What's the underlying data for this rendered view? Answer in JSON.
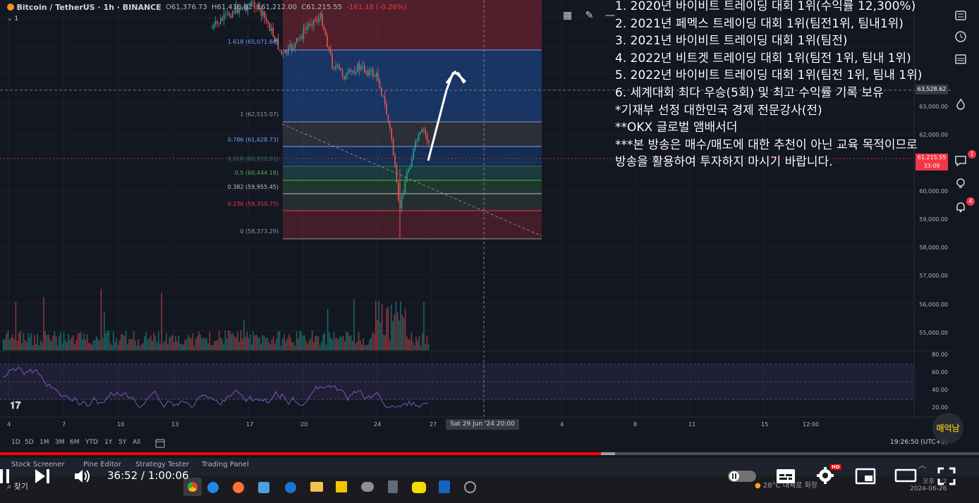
{
  "header": {
    "symbol": "Bitcoin / TetherUS · 1h · BINANCE",
    "interval_badge": "1",
    "ohlc": {
      "o": "O61,376.73",
      "h": "H61,418.82",
      "l": "L61,212.00",
      "c": "C61,215.55",
      "chg": "-161.18 (-0.26%)"
    }
  },
  "fib_levels": [
    {
      "label": "1.618 (65,071.68)",
      "color": "#6aa1ff"
    },
    {
      "label": "1 (62,515.07)",
      "color": "#9598a1"
    },
    {
      "label": "0.786 (61,628.73)",
      "color": "#6aa1ff"
    },
    {
      "label": "0.618 (60,932.91)",
      "color": "#2a7a6f"
    },
    {
      "label": "0.5 (60,444.18)",
      "color": "#4caf50"
    },
    {
      "label": "0.382 (59,955.45)",
      "color": "#c0c0c0"
    },
    {
      "label": "0.236 (59,350.75)",
      "color": "#f23645"
    },
    {
      "label": "0 (58,373.29)",
      "color": "#9598a1"
    }
  ],
  "price_axis": [
    "63,000.00",
    "62,000.00",
    "60,000.00",
    "59,000.00",
    "58,000.00",
    "57,000.00",
    "56,000.00",
    "55,000.00"
  ],
  "rsi_axis": [
    "80.00",
    "60.00",
    "40.00",
    "20.00"
  ],
  "price_tags": {
    "cross": "63,528.62",
    "last": "61,215.55",
    "countdown": "33:09"
  },
  "overlay_lines": [
    "1. 2020년 바이비트 트레이딩 대회 1위(수익률 12,300%)",
    "2. 2021년 페멕스 트레이딩 대회 1위(팀전1위, 팀내1위)",
    "3. 2021년 바이비트 트레이딩 대회 1위(팀전)",
    "4. 2022년 비트겟 트레이딩 대회 1위(팀전 1위, 팀내 1위)",
    "5. 2022년 바이비트 트레이딩 대회 1위(팀전 1위, 팀내 1위)",
    "6. 세계대회 최다 우승(5회) 및 최고 수익률 기록 보유",
    "*기재부 선정 대한민국 경제 전문강사(전)",
    "**OKX 글로벌 앰배서더",
    "***본 방송은 매수/매도에 대한 추천이 아닌 교육 목적이므로",
    " 방송을 활용하여 투자하지 마시기 바랍니다."
  ],
  "time_axis": [
    "4",
    "7",
    "10",
    "13",
    "17",
    "20",
    "24",
    "27",
    "4",
    "8",
    "11",
    "15",
    "12:00"
  ],
  "time_cursor": "Sat 29 Jun '24   20:00",
  "timeframes": [
    "1D",
    "5D",
    "1M",
    "3M",
    "6M",
    "YTD",
    "1Y",
    "5Y",
    "All"
  ],
  "clock": "19:26:50 (UTC+9)",
  "bottom_tabs": [
    "Stock Screener",
    "Pine Editor",
    "Strategy Tester",
    "Trading Panel"
  ],
  "player": {
    "time": "36:52 / 1:00:06",
    "progress": 0.6137,
    "buffered": 0.628
  },
  "taskbar": {
    "search": "찾기",
    "weather": "28°C 대체로 화창",
    "date": "2024-06-26",
    "time": "오후 7:2"
  },
  "badges": {
    "alerts": "1",
    "notifications": "4",
    "hd": "HD"
  },
  "watermark": "매억남",
  "colors": {
    "bg": "#131722",
    "up": "#26a69a",
    "down": "#ef5350",
    "progress": "#ff0000"
  }
}
